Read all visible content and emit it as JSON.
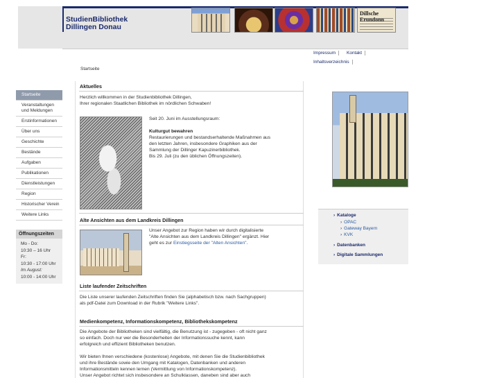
{
  "header": {
    "title_line1": "StudienBibliothek",
    "title_line2": "Dillingen Donau",
    "thumb5_text": "Dillsche Erundonn"
  },
  "toplinks": {
    "impressum": "Impressum",
    "kontakt": "Kontakt",
    "inhaltsverzeichnis": "Inhaltsverzeichnis"
  },
  "breadcrumb": "Startseite",
  "nav": {
    "items": [
      "Startseite",
      "Veranstaltungen und Meldungen",
      "Erstinformationen",
      "Über uns",
      "Geschichte",
      "Bestände",
      "Aufgaben",
      "Publikationen",
      "Dienstleistungen",
      "Region",
      "Historischer Verein",
      "Weitere Links"
    ]
  },
  "hours": {
    "title": "Öffnungszeiten",
    "l1": "Mo - Do:",
    "l2": "10:30 – 16 Uhr",
    "l3": "Fr:",
    "l4": "10:30 - 17:00 Uhr",
    "l5": "Im August:",
    "l6": "10:00 - 14:00 Uhr"
  },
  "main": {
    "aktuelles_title": "Aktuelles",
    "welcome1": "Herzlich willkommen in der Studienbibliothek Dillingen,",
    "welcome2": "Ihrer regionalen Staatlichen Bibliothek im nördlichen Schwaben!",
    "exhibit_intro": "Seit 20. Juni im Ausstellungsraum:",
    "exhibit_title": "Kulturgut bewahren",
    "exhibit_l1": "Restaurierungen und bestandserhaltende Maßnahmen aus",
    "exhibit_l2": "den letzten Jahren, insbesondere Graphiken aus der",
    "exhibit_l3": "Sammlung der Dillinger Kapuzinerbibliothek.",
    "exhibit_l4": "Bis 29. Juli (zu den üblichen Öffnungszeiten).",
    "ansichten_title": "Alte Ansichten aus dem Landkreis Dillingen",
    "ansichten_l1": "Unser Angebot zur Region haben wir durch digitalisierte",
    "ansichten_l2": "\"Alte Ansichten aus dem Landkreis Dillingen\" ergänzt. Hier",
    "ansichten_l3a": "geht es zur ",
    "ansichten_link": "Einstiegsseite der \"Alten Ansichten\"",
    "ansichten_l3b": ".",
    "zeitschriften_title": "Liste laufender Zeitschriften",
    "zeit_l1": "Die Liste unserer laufenden Zeitschriften finden Sie (alphabetisch bzw. nach Sachgruppen)",
    "zeit_l2": "als pdf-Datei zum Download in der Rubrik \"Weitere Links\".",
    "medien_title": "Medienkompetenz, Informationskompetenz, Bibliothekskompetenz",
    "med_l1": "Die Angebote der Bibliotheken sind vielfältig, die Benutzung ist - zugegeben - oft nicht ganz",
    "med_l2": "so einfach. Doch nur wer die Besonderheiten der Informationssuche kennt, kann",
    "med_l3": "erfolgreich und effizient Bibliotheken benutzen.",
    "med_l4": "Wir bieten Ihnen verschiedene (kostenlose) Angebote, mit denen Sie die Studienbibliothek",
    "med_l5": "und ihre Bestände sowie den Umgang mit Katalogen, Datenbanken und anderen",
    "med_l6": "Informationsmitteln kennen lernen (Vermittlung von Informationskompetenz).",
    "med_l7": "Unser Angebot richtet sich insbesondere an Schulklassen, daneben sind aber auch"
  },
  "right": {
    "kataloge": "Kataloge",
    "opac": "OPAC",
    "gateway": "Gateway Bayern",
    "kvk": "KVK",
    "datenbanken": "Datenbanken",
    "digitale": "Digitale Sammlungen"
  }
}
